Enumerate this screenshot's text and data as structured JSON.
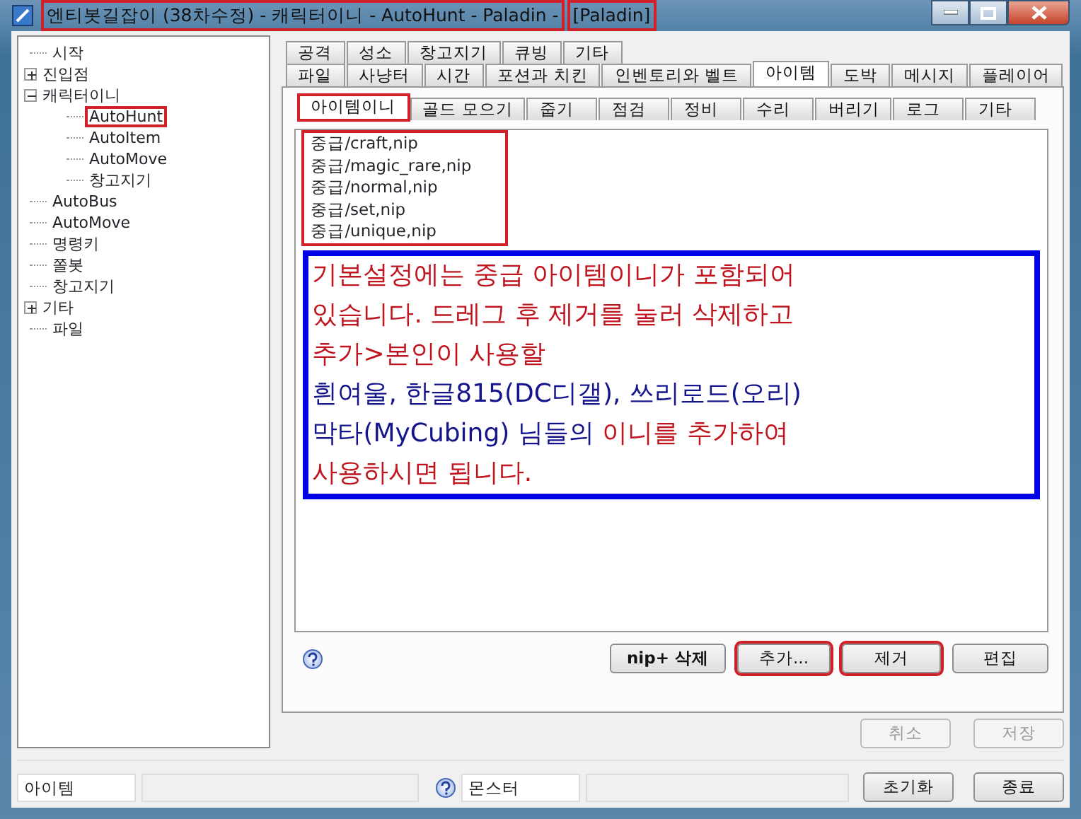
{
  "window": {
    "title_parts": [
      {
        "text": "엔티봇길잡이 (38차수정) - 캐릭터이니 - AutoHunt - Paladin -",
        "highlighted": true
      },
      {
        "text": "[Paladin]",
        "highlighted": true
      }
    ]
  },
  "tree": [
    {
      "label": "시작"
    },
    {
      "label": "진입점",
      "expanded": false
    },
    {
      "label": "캐릭터이니",
      "expanded": true,
      "children": [
        {
          "label": "AutoHunt",
          "highlighted": true
        },
        {
          "label": "AutoItem",
          "highlighted": false
        },
        {
          "label": "AutoMove",
          "highlighted": false
        },
        {
          "label": "창고지기",
          "highlighted": false
        }
      ]
    },
    {
      "label": "AutoBus"
    },
    {
      "label": "AutoMove"
    },
    {
      "label": "명령키"
    },
    {
      "label": "쫄봇"
    },
    {
      "label": "창고지기"
    },
    {
      "label": "기타",
      "expanded": false
    },
    {
      "label": "파일"
    }
  ],
  "tab_rows": [
    [
      {
        "label": "공격",
        "selected": false
      },
      {
        "label": "성소",
        "selected": false
      },
      {
        "label": "창고지기",
        "selected": false
      },
      {
        "label": "큐빙",
        "selected": false
      },
      {
        "label": "기타",
        "selected": false
      }
    ],
    [
      {
        "label": "파일",
        "selected": false
      },
      {
        "label": "사냥터",
        "selected": false
      },
      {
        "label": "시간",
        "selected": false
      },
      {
        "label": "포션과 치킨",
        "selected": false
      },
      {
        "label": "인벤토리와 벨트",
        "selected": false
      },
      {
        "label": "아이템",
        "selected": true
      },
      {
        "label": "도박",
        "selected": false
      },
      {
        "label": "메시지",
        "selected": false
      },
      {
        "label": "플레이어",
        "selected": false
      }
    ]
  ],
  "sub_tabs": [
    {
      "label": "아이템이니",
      "selected": true,
      "highlighted": true
    },
    {
      "label": "골드 모으기",
      "selected": false,
      "highlighted": false
    },
    {
      "label": "줍기",
      "selected": false,
      "highlighted": false
    },
    {
      "label": "점검",
      "selected": false,
      "highlighted": false
    },
    {
      "label": "정비",
      "selected": false,
      "highlighted": false
    },
    {
      "label": "수리",
      "selected": false,
      "highlighted": false
    },
    {
      "label": "버리기",
      "selected": false,
      "highlighted": false
    },
    {
      "label": "로그",
      "selected": false,
      "highlighted": false
    },
    {
      "label": "기타",
      "selected": false,
      "highlighted": false
    }
  ],
  "file_list": {
    "highlighted": true,
    "items": [
      "중급/craft,nip",
      "중급/magic_rare,nip",
      "중급/normal,nip",
      "중급/set,nip",
      "중급/unique,nip"
    ]
  },
  "note": {
    "lines": [
      [
        {
          "text": "기본설정에는 중급 아이템이니가 포함되어",
          "color": "#c0141e"
        }
      ],
      [
        {
          "text": "있습니다. 드레그 후 제거를 눌러 삭제하고",
          "color": "#c0141e"
        }
      ],
      [
        {
          "text": "추가>본인이 사용할",
          "color": "#c0141e"
        }
      ],
      [
        {
          "text": "흰여울, 한글815(DC디갤), 쓰리로드(오리)",
          "color": "#14148c"
        }
      ],
      [
        {
          "text": "막타(MyCubing) 님들의 ",
          "color": "#14148c"
        },
        {
          "text": "이니를 추가하여",
          "color": "#c0141e"
        }
      ],
      [
        {
          "text": "사용하시면 됩니다.",
          "color": "#c0141e"
        }
      ]
    ]
  },
  "list_buttons": [
    {
      "label": "nip+ 삭제",
      "highlighted": false,
      "bold": true
    },
    {
      "label": "추가...",
      "highlighted": true,
      "bold": false
    },
    {
      "label": "제거",
      "highlighted": true,
      "bold": false
    },
    {
      "label": "편집",
      "highlighted": false,
      "bold": false
    }
  ],
  "page_buttons": [
    {
      "label": "취소",
      "disabled": true
    },
    {
      "label": "저장",
      "disabled": true
    }
  ],
  "status_bar": {
    "left_field": "아이템",
    "right_field": "몬스터",
    "buttons": [
      {
        "label": "초기화",
        "disabled": false
      },
      {
        "label": "종료",
        "disabled": false
      }
    ]
  }
}
